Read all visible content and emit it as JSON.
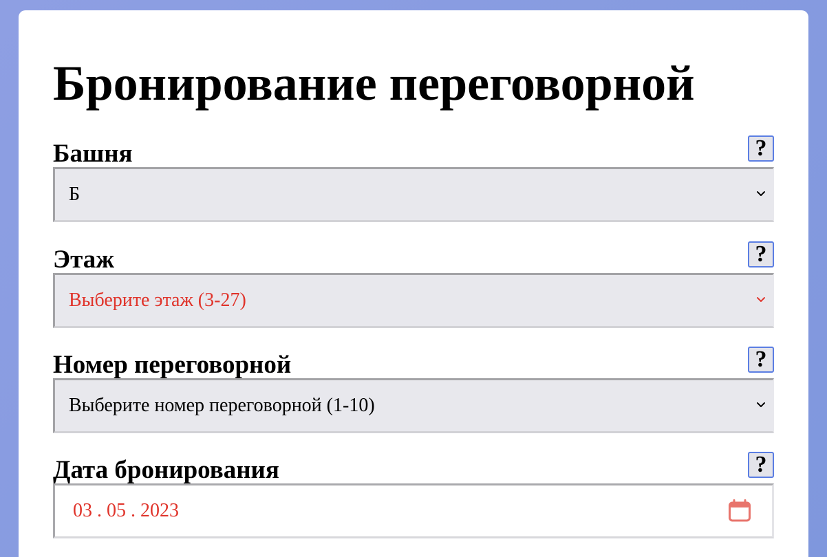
{
  "page": {
    "title": "Бронирование переговорной"
  },
  "fields": {
    "tower": {
      "label": "Башня",
      "help": "?",
      "value": "Б"
    },
    "floor": {
      "label": "Этаж",
      "help": "?",
      "placeholder": "Выберите этаж (3-27)"
    },
    "room": {
      "label": "Номер переговорной",
      "help": "?",
      "placeholder": "Выберите номер переговорной (1-10)"
    },
    "date": {
      "label": "Дата бронирования",
      "help": "?",
      "value": "03 . 05 . 2023"
    }
  },
  "colors": {
    "background": "#8a9fe0",
    "card": "#ffffff",
    "accent_red": "#e0342b",
    "help_border": "#5b7ee3",
    "select_bg": "#e8e8ed"
  },
  "icons": {
    "select_arrow": "chevron-down-icon",
    "date_picker": "calendar-icon"
  }
}
